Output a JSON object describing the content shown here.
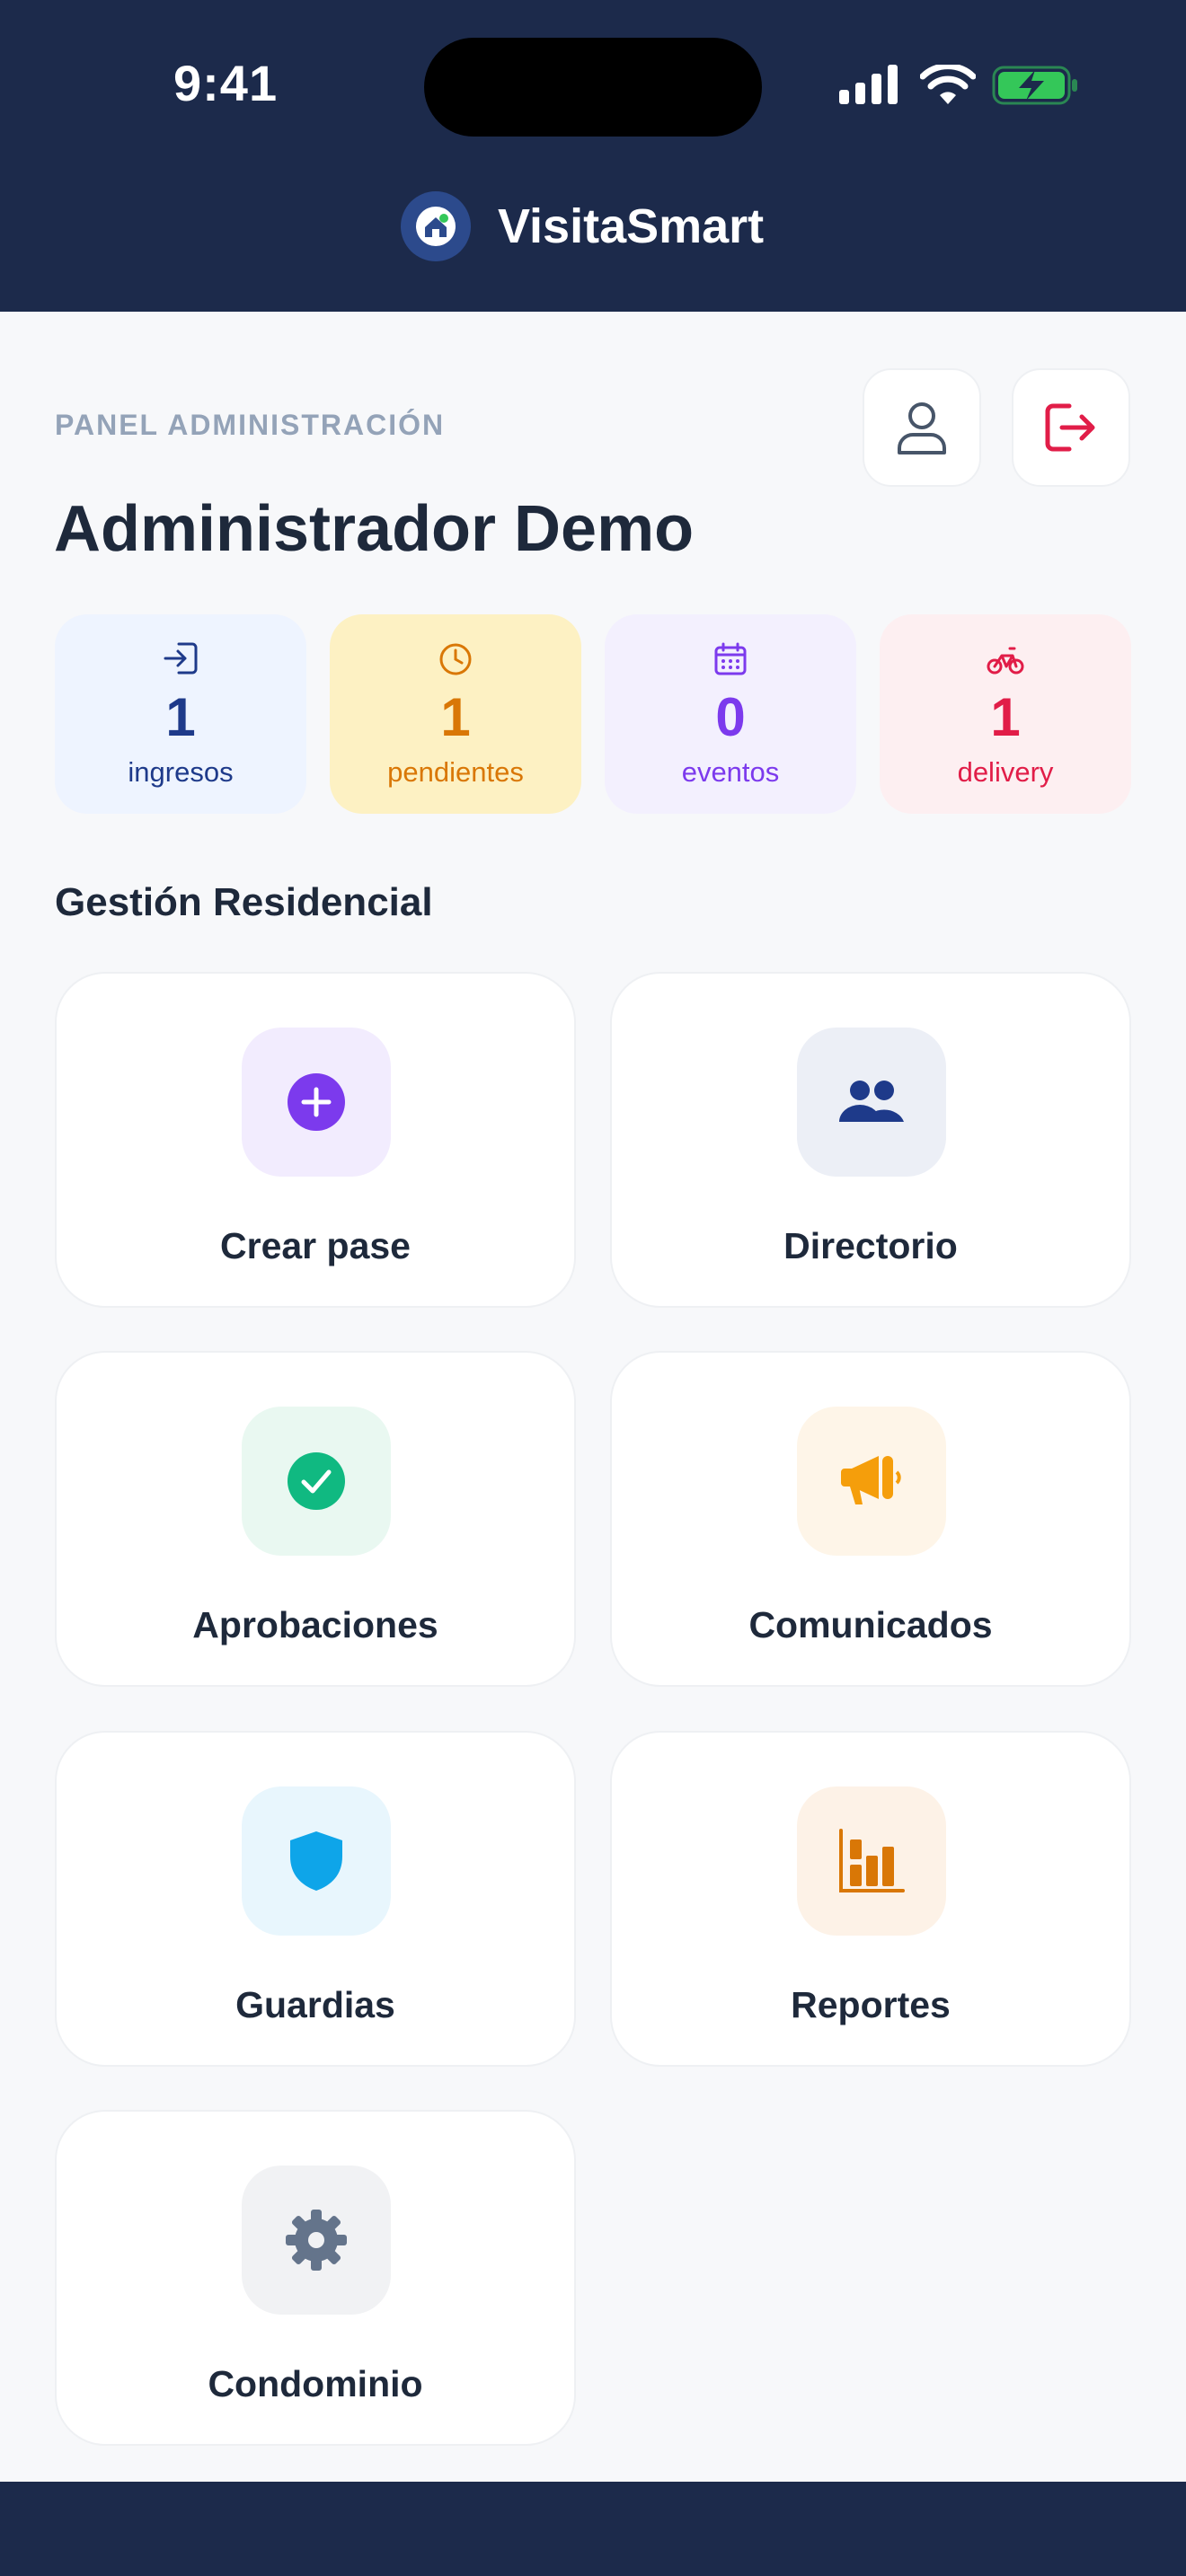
{
  "status_bar": {
    "time": "9:41"
  },
  "app": {
    "name": "VisitaSmart",
    "logo_icon": "home-shield-icon",
    "brand_color": "#1c2a4b"
  },
  "header": {
    "panel_label": "PANEL ADMINISTRACIÓN",
    "admin_name": "Administrador Demo",
    "profile_icon": "user-icon",
    "logout_icon": "logout-icon"
  },
  "stats": [
    {
      "icon": "login-icon",
      "value": "1",
      "label": "ingresos",
      "color": "#1e3a8a",
      "bg": "#eef4ff"
    },
    {
      "icon": "clock-icon",
      "value": "1",
      "label": "pendientes",
      "color": "#d97706",
      "bg": "#fdf1c3"
    },
    {
      "icon": "calendar-icon",
      "value": "0",
      "label": "eventos",
      "color": "#7c3aed",
      "bg": "#f3f0fe"
    },
    {
      "icon": "bicycle-icon",
      "value": "1",
      "label": "delivery",
      "color": "#e11d48",
      "bg": "#fdeff1"
    }
  ],
  "section_title": "Gestión Residencial",
  "cards": [
    {
      "label": "Crear pase",
      "icon": "plus-circle-icon",
      "color": "#7c3aed",
      "bg": "#f2ecfe"
    },
    {
      "label": "Directorio",
      "icon": "users-icon",
      "color": "#1e3a8a",
      "bg": "#eceff6"
    },
    {
      "label": "Aprobaciones",
      "icon": "check-circle-icon",
      "color": "#10b981",
      "bg": "#e9f8f1"
    },
    {
      "label": "Comunicados",
      "icon": "megaphone-icon",
      "color": "#f59e0b",
      "bg": "#fef5e8"
    },
    {
      "label": "Guardias",
      "icon": "shield-icon",
      "color": "#0ea5e9",
      "bg": "#e8f6fd"
    },
    {
      "label": "Reportes",
      "icon": "bar-chart-icon",
      "color": "#d97706",
      "bg": "#fdf2e7"
    },
    {
      "label": "Condominio",
      "icon": "gear-icon",
      "color": "#64748b",
      "bg": "#f1f2f4"
    }
  ]
}
